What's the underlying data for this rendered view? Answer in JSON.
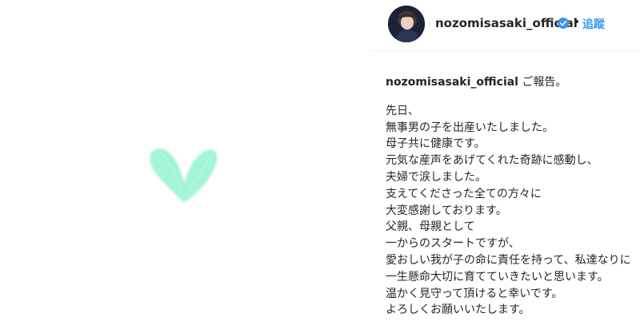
{
  "post": {
    "image_alt": "mint green heart drawing on white background"
  },
  "header": {
    "username": "nozomisasaki_official",
    "separator": "•",
    "follow_label": "追蹤"
  },
  "caption": {
    "username": "nozomisasaki_official",
    "first_line": " ご報告。",
    "lines": [
      "先日、",
      "無事男の子を出産いたしました。",
      "母子共に健康です。",
      "元気な産声をあげてくれた奇跡に感動し、",
      "夫婦で涙しました。",
      "支えてくださった全ての方々に",
      "大変感謝しております。",
      "父親、母親として",
      "一からのスタートですが、",
      "愛おしい我が子の命に責任を持って、私達なりに一生懸命大切に育てていきたいと思います。",
      "温かく見守って頂けると幸いです。",
      "よろしくお願いいたします。"
    ]
  },
  "colors": {
    "heart": "#9ff5d2",
    "link": "#3897f0",
    "text": "#262626",
    "verified": "#3897f0"
  }
}
